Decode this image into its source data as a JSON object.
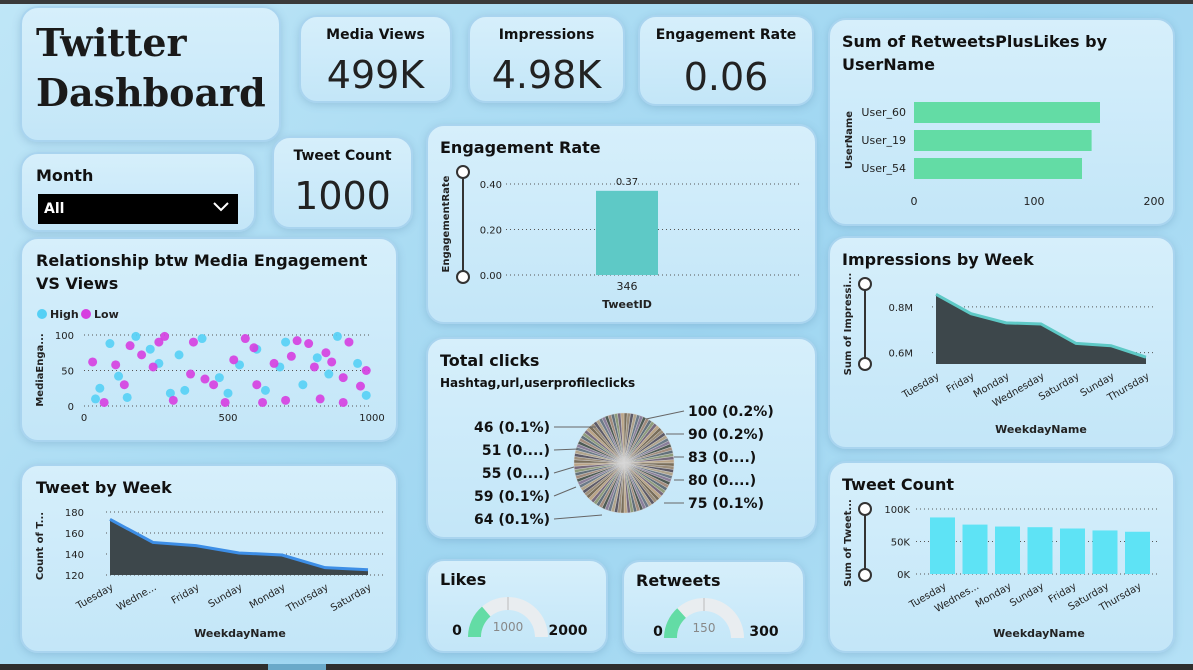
{
  "title": "Twitter Dashboard",
  "kpis": {
    "media_views": {
      "label": "Media Views",
      "value": "499K"
    },
    "impressions": {
      "label": "Impressions",
      "value": "4.98K"
    },
    "engagement_rate": {
      "label": "Engagement Rate",
      "value": "0.06"
    },
    "tweet_count": {
      "label": "Tweet Count",
      "value": "1000"
    }
  },
  "month_filter": {
    "label": "Month",
    "selected": "All"
  },
  "colors": {
    "teal": "#5ec9c6",
    "green": "#63dca5",
    "cyan": "#5ee3f5",
    "dark_area": "#3d474b",
    "line_blue": "#3d8ee6",
    "high": "#55d0f5",
    "low": "#d63ee0"
  },
  "chart_data": [
    {
      "id": "retweets_likes",
      "type": "bar",
      "orientation": "horizontal",
      "title": "Sum of RetweetsPlusLikes by UserName",
      "ylabel": "UserName",
      "categories": [
        "User_60",
        "User_19",
        "User_54"
      ],
      "values": [
        155,
        148,
        140
      ],
      "xlim": [
        0,
        200
      ],
      "xticks": [
        "0",
        "100",
        "200"
      ]
    },
    {
      "id": "engagement_rate",
      "type": "bar",
      "title": "Engagement Rate",
      "xlabel": "TweetID",
      "ylabel": "EngagementRate",
      "categories": [
        "346"
      ],
      "values": [
        0.37
      ],
      "data_labels": [
        "0.37"
      ],
      "ylim": [
        0,
        0.45
      ],
      "yticks": [
        "0.00",
        "0.20",
        "0.40"
      ]
    },
    {
      "id": "media_scatter",
      "type": "scatter",
      "title": "Relationship btw Media Engagement VS Views",
      "ylabel": "MediaEnga...",
      "legend": [
        {
          "name": "High"
        },
        {
          "name": "Low"
        }
      ],
      "xlim": [
        0,
        1000
      ],
      "ylim": [
        0,
        100
      ],
      "xticks": [
        "0",
        "500",
        "1000"
      ],
      "yticks": [
        "0",
        "50",
        "100"
      ],
      "high": [
        [
          40,
          10
        ],
        [
          55,
          25
        ],
        [
          120,
          42
        ],
        [
          180,
          98
        ],
        [
          230,
          80
        ],
        [
          260,
          60
        ],
        [
          300,
          18
        ],
        [
          350,
          22
        ],
        [
          410,
          95
        ],
        [
          470,
          40
        ],
        [
          540,
          58
        ],
        [
          600,
          80
        ],
        [
          630,
          22
        ],
        [
          700,
          90
        ],
        [
          760,
          30
        ],
        [
          810,
          68
        ],
        [
          880,
          98
        ],
        [
          950,
          60
        ],
        [
          980,
          15
        ],
        [
          90,
          88
        ],
        [
          150,
          12
        ],
        [
          330,
          72
        ],
        [
          500,
          18
        ],
        [
          680,
          55
        ],
        [
          850,
          45
        ]
      ],
      "low": [
        [
          30,
          62
        ],
        [
          70,
          5
        ],
        [
          110,
          58
        ],
        [
          160,
          85
        ],
        [
          200,
          72
        ],
        [
          240,
          55
        ],
        [
          280,
          98
        ],
        [
          310,
          8
        ],
        [
          380,
          90
        ],
        [
          420,
          38
        ],
        [
          450,
          30
        ],
        [
          490,
          5
        ],
        [
          520,
          65
        ],
        [
          560,
          95
        ],
        [
          600,
          30
        ],
        [
          620,
          5
        ],
        [
          660,
          60
        ],
        [
          720,
          70
        ],
        [
          740,
          92
        ],
        [
          780,
          88
        ],
        [
          820,
          10
        ],
        [
          840,
          75
        ],
        [
          860,
          62
        ],
        [
          900,
          40
        ],
        [
          920,
          90
        ],
        [
          960,
          28
        ],
        [
          980,
          50
        ],
        [
          140,
          30
        ],
        [
          260,
          90
        ],
        [
          370,
          45
        ],
        [
          590,
          82
        ],
        [
          700,
          8
        ],
        [
          900,
          5
        ],
        [
          800,
          55
        ]
      ]
    },
    {
      "id": "impressions_week",
      "type": "area",
      "title": "Impressions by Week",
      "xlabel": "WeekdayName",
      "ylabel": "Sum of Impressi...",
      "categories": [
        "Tuesday",
        "Friday",
        "Monday",
        "Wednesday",
        "Saturday",
        "Sunday",
        "Thursday"
      ],
      "values": [
        0.855,
        0.77,
        0.73,
        0.725,
        0.64,
        0.63,
        0.58
      ],
      "ylim": [
        0.55,
        0.9
      ],
      "yticks": [
        "0.6M",
        "0.8M"
      ],
      "ytick_values": [
        0.6,
        0.8
      ]
    },
    {
      "id": "tweet_week",
      "type": "area",
      "title": "Tweet by Week",
      "xlabel": "WeekdayName",
      "ylabel": "Count of T...",
      "categories": [
        "Tuesday",
        "Wedne...",
        "Friday",
        "Sunday",
        "Monday",
        "Thursday",
        "Saturday"
      ],
      "values": [
        173,
        151,
        148,
        141,
        139,
        127,
        125
      ],
      "ylim": [
        120,
        180
      ],
      "yticks": [
        "120",
        "140",
        "160",
        "180"
      ],
      "ytick_values": [
        120,
        140,
        160,
        180
      ]
    },
    {
      "id": "tweet_count",
      "type": "bar",
      "title": "Tweet Count",
      "xlabel": "WeekdayName",
      "ylabel": "Sum of Tweet...",
      "categories": [
        "Tuesday",
        "Wednes...",
        "Monday",
        "Sunday",
        "Friday",
        "Saturday",
        "Thursday"
      ],
      "values": [
        87000,
        76000,
        73000,
        72000,
        70000,
        67000,
        65000
      ],
      "ylim": [
        0,
        100000
      ],
      "yticks": [
        "0K",
        "50K",
        "100K"
      ],
      "ytick_values": [
        0,
        50000,
        100000
      ]
    },
    {
      "id": "total_clicks",
      "type": "pie",
      "title": "Total clicks",
      "subtitle": "Hashtag,url,userprofileclicks",
      "labels_left": [
        "46 (0.1%)",
        "51 (0....)",
        "55 (0....)",
        "59 (0.1%)",
        "64 (0.1%)"
      ],
      "labels_right": [
        "100 (0.2%)",
        "90 (0.2%)",
        "83 (0....)",
        "80 (0....)",
        "75 (0.1%)"
      ]
    },
    {
      "id": "likes",
      "type": "gauge",
      "title": "Likes",
      "min": "0",
      "max": "2000",
      "target": "1000",
      "value": 550,
      "max_value": 2000
    },
    {
      "id": "retweets",
      "type": "gauge",
      "title": "Retweets",
      "min": "0",
      "max": "300",
      "target": "150",
      "value": 80,
      "max_value": 300
    }
  ]
}
